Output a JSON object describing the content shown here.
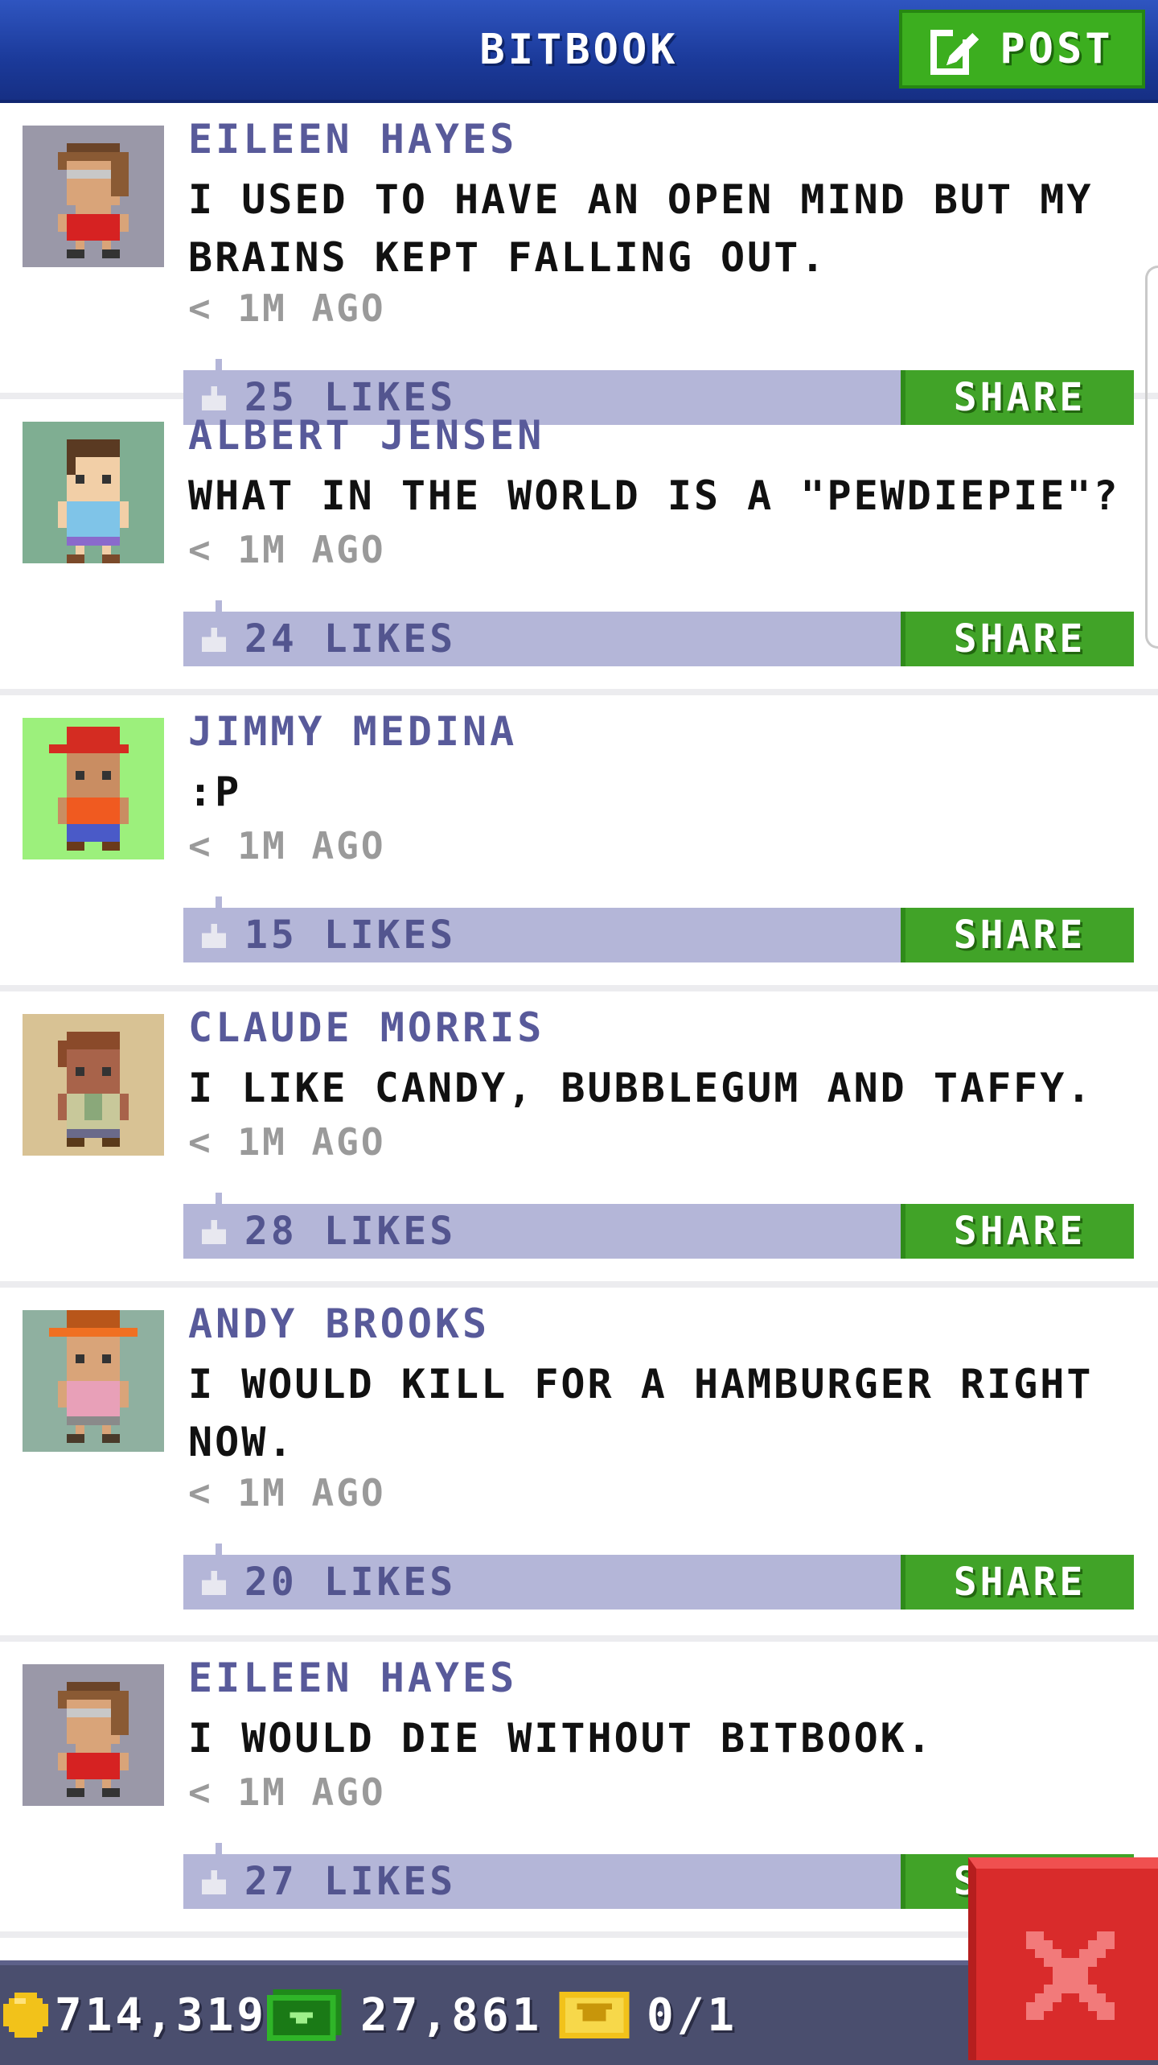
{
  "header": {
    "title": "BITBOOK",
    "post_label": "POST"
  },
  "posts": [
    {
      "name": "EILEEN HAYES",
      "text": "I USED TO HAVE AN OPEN MIND BUT MY BRAINS KEPT FALLING OUT.",
      "time": "< 1M AGO",
      "likes": "25 LIKES",
      "share": "SHARE",
      "avatar_bg": "#9a98a8"
    },
    {
      "name": "ALBERT JENSEN",
      "text": "WHAT IN THE WORLD IS A \"PEWDIEPIE\"?",
      "time": "< 1M AGO",
      "likes": "24 LIKES",
      "share": "SHARE",
      "avatar_bg": "#7fae92"
    },
    {
      "name": "JIMMY MEDINA",
      "text": ":P",
      "time": "< 1M AGO",
      "likes": "15 LIKES",
      "share": "SHARE",
      "avatar_bg": "#9cf07c"
    },
    {
      "name": "CLAUDE MORRIS",
      "text": "I LIKE CANDY, BUBBLEGUM AND TAFFY.",
      "time": "< 1M AGO",
      "likes": "28 LIKES",
      "share": "SHARE",
      "avatar_bg": "#d8c294"
    },
    {
      "name": "ANDY BROOKS",
      "text": "I WOULD KILL FOR A HAMBURGER RIGHT NOW.",
      "time": "< 1M AGO",
      "likes": "20 LIKES",
      "share": "SHARE",
      "avatar_bg": "#8fb0a0"
    },
    {
      "name": "EILEEN HAYES",
      "text": "I WOULD DIE WITHOUT BITBOOK.",
      "time": "< 1M AGO",
      "likes": "27 LIKES",
      "share": "SHARE",
      "avatar_bg": "#9a98a8"
    }
  ],
  "footer": {
    "coins": "714,319",
    "bux": "27,861",
    "tickets": "0/1"
  },
  "colors": {
    "header_blue": "#1b3a9a",
    "post_green": "#3cae1f",
    "likes_bar": "#b4b6d8",
    "name_purple": "#585a9a",
    "close_red": "#d92b2b"
  },
  "icons": [
    "edit-icon",
    "like-icon",
    "coin-icon",
    "bux-icon",
    "ticket-icon",
    "close-icon"
  ]
}
